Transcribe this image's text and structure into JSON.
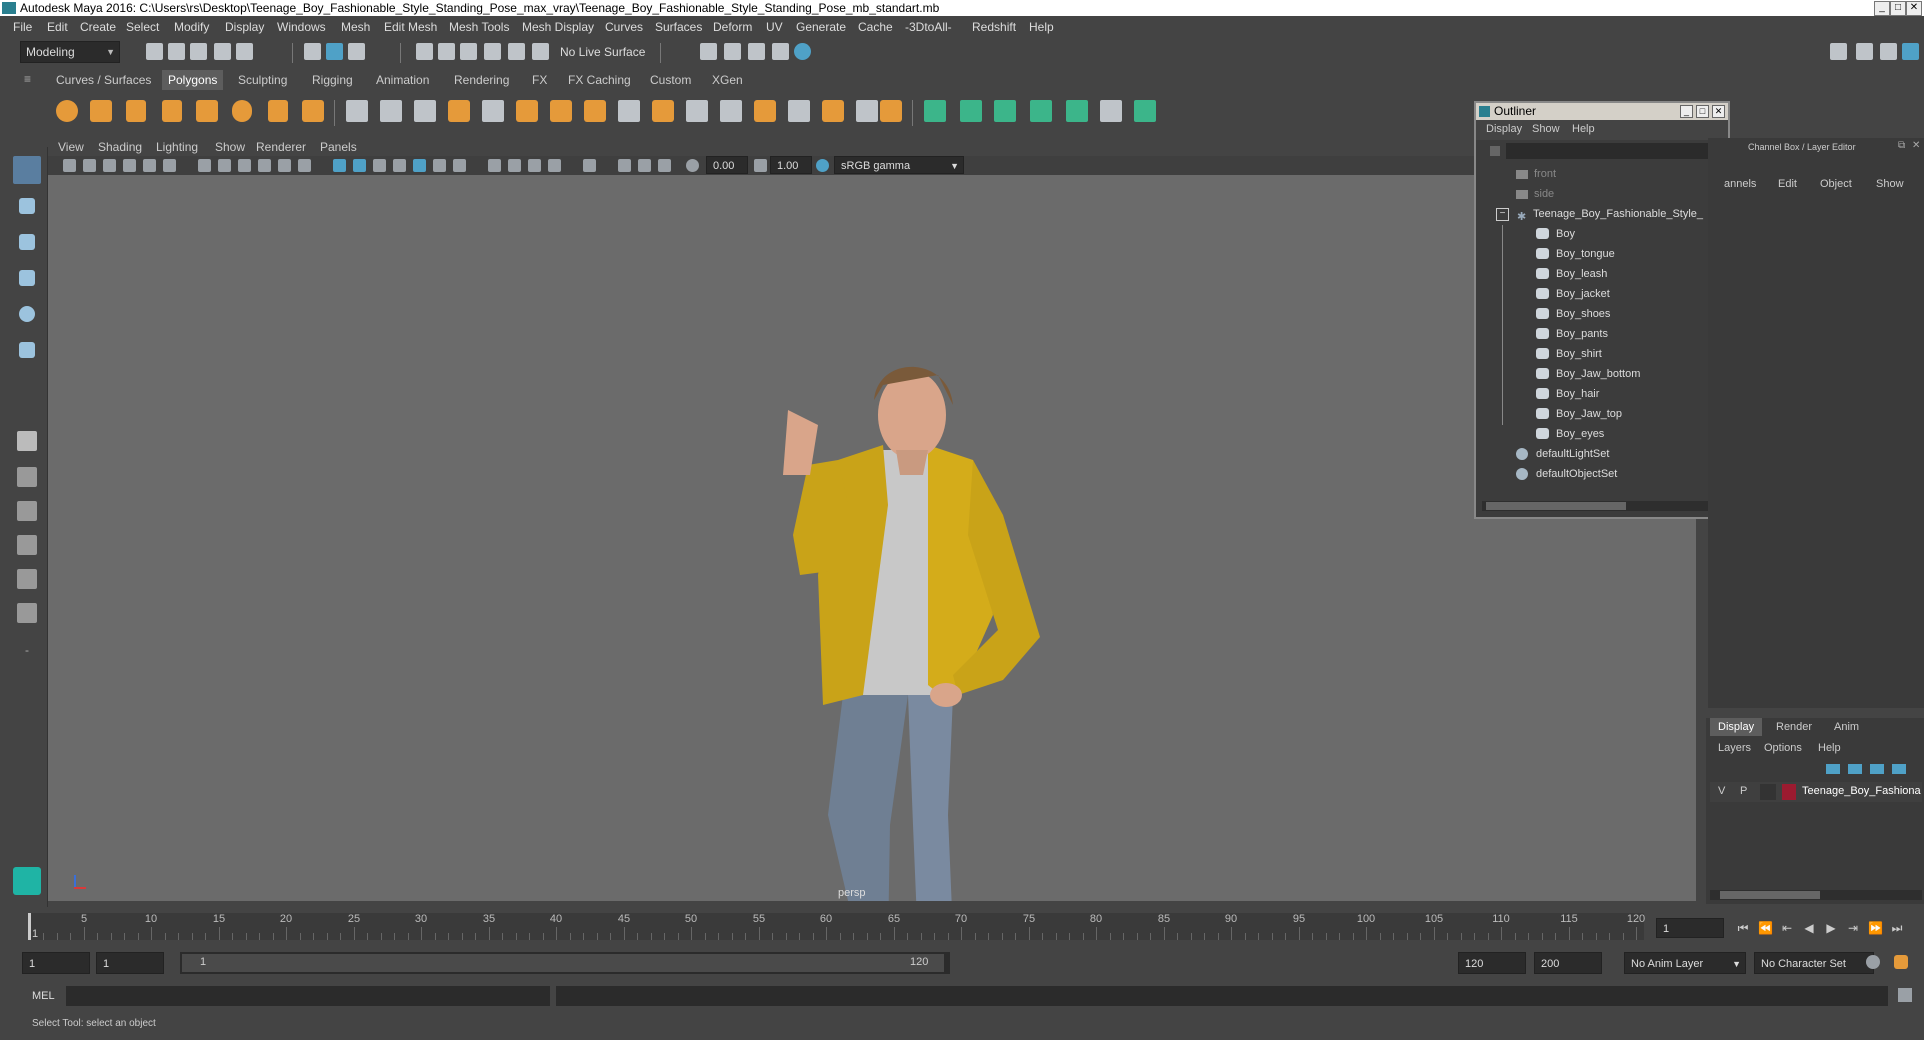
{
  "window": {
    "title": "Autodesk Maya 2016: C:\\Users\\rs\\Desktop\\Teenage_Boy_Fashionable_Style_Standing_Pose_max_vray\\Teenage_Boy_Fashionable_Style_Standing_Pose_mb_standart.mb"
  },
  "menubar": [
    "File",
    "Edit",
    "Create",
    "Select",
    "Modify",
    "Display",
    "Windows",
    "Mesh",
    "Edit Mesh",
    "Mesh Tools",
    "Mesh Display",
    "Curves",
    "Surfaces",
    "Deform",
    "UV",
    "Generate",
    "Cache",
    "-3DtoAll-",
    "Redshift",
    "Help"
  ],
  "toolbar": {
    "mode": "Modeling",
    "live_surface": "No Live Surface"
  },
  "shelf": {
    "tabs": [
      "Curves / Surfaces",
      "Polygons",
      "Sculpting",
      "Rigging",
      "Animation",
      "Rendering",
      "FX",
      "FX Caching",
      "Custom",
      "XGen"
    ],
    "active_tab": "Polygons"
  },
  "viewport": {
    "menu": [
      "View",
      "Shading",
      "Lighting",
      "Show",
      "Renderer",
      "Panels"
    ],
    "exposure": "0.00",
    "gamma": "1.00",
    "color_space": "sRGB gamma",
    "camera_label": "persp"
  },
  "outliner": {
    "title": "Outliner",
    "menu": [
      "Display",
      "Show",
      "Help"
    ],
    "items": [
      {
        "label": "front",
        "type": "camera",
        "level": 0
      },
      {
        "label": "side",
        "type": "camera",
        "level": 0
      },
      {
        "label": "Teenage_Boy_Fashionable_Style_",
        "type": "group",
        "level": 0
      },
      {
        "label": "Boy",
        "type": "mesh",
        "level": 1
      },
      {
        "label": "Boy_tongue",
        "type": "mesh",
        "level": 1
      },
      {
        "label": "Boy_leash",
        "type": "mesh",
        "level": 1
      },
      {
        "label": "Boy_jacket",
        "type": "mesh",
        "level": 1
      },
      {
        "label": "Boy_shoes",
        "type": "mesh",
        "level": 1
      },
      {
        "label": "Boy_pants",
        "type": "mesh",
        "level": 1
      },
      {
        "label": "Boy_shirt",
        "type": "mesh",
        "level": 1
      },
      {
        "label": "Boy_Jaw_bottom",
        "type": "mesh",
        "level": 1
      },
      {
        "label": "Boy_hair",
        "type": "mesh",
        "level": 1
      },
      {
        "label": "Boy_Jaw_top",
        "type": "mesh",
        "level": 1
      },
      {
        "label": "Boy_eyes",
        "type": "mesh",
        "level": 1
      },
      {
        "label": "defaultLightSet",
        "type": "set",
        "level": 0
      },
      {
        "label": "defaultObjectSet",
        "type": "set",
        "level": 0
      }
    ]
  },
  "channelbox": {
    "title": "Channel Box / Layer Editor",
    "menu": [
      "annels",
      "Edit",
      "Object",
      "Show"
    ]
  },
  "layers": {
    "tabs": [
      "Display",
      "Render",
      "Anim"
    ],
    "active_tab": "Display",
    "menu": [
      "Layers",
      "Options",
      "Help"
    ],
    "layer": {
      "v": "V",
      "p": "P",
      "name": "Teenage_Boy_Fashiona",
      "color": "#9b1b30"
    }
  },
  "timeline": {
    "ticks": [
      "5",
      "10",
      "15",
      "20",
      "25",
      "30",
      "35",
      "40",
      "45",
      "50",
      "55",
      "60",
      "65",
      "70",
      "75",
      "80",
      "85",
      "90",
      "95",
      "100",
      "105",
      "110",
      "115",
      "120"
    ],
    "start_label": "1",
    "current_frame": "1"
  },
  "range": {
    "start": "1",
    "start2": "1",
    "range_start": "1",
    "range_end": "120",
    "end": "120",
    "end2": "200",
    "anim_layer": "No Anim Layer",
    "character_set": "No Character Set"
  },
  "mel": {
    "label": "MEL"
  },
  "help": {
    "text": "Select Tool: select an object"
  }
}
